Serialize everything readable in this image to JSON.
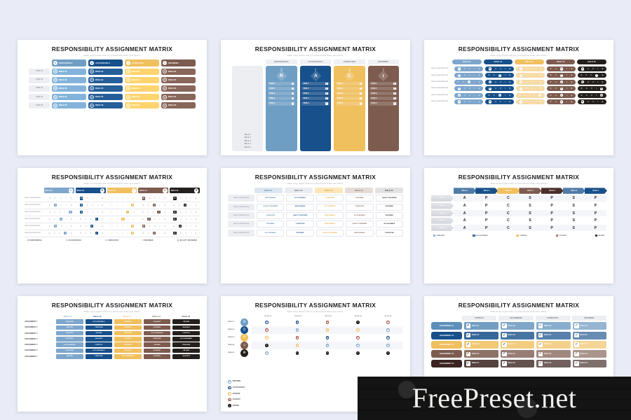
{
  "common": {
    "title": "RESPONSIBILITY ASSIGNMENT MATRIX",
    "subtitle": "Make a big impact with our professional slides and charts."
  },
  "palette": {
    "light_blue": "#7ea6cc",
    "navy": "#17508a",
    "gold": "#f0bf5e",
    "brown": "#7d5b4f",
    "dark": "#24201d",
    "steel": "#4f7ba6",
    "grey": "#eceef2",
    "page_bg": "#e9ecf6"
  },
  "watermark": {
    "text": "FreePreset.net"
  },
  "slide1": {
    "header": [
      {
        "letter": "R",
        "label": "RESPONSIBLE",
        "color": "#6f9ec4"
      },
      {
        "letter": "A",
        "label": "ACCOUNTABLE",
        "color": "#17508a"
      },
      {
        "letter": "C",
        "label": "CONSULTED",
        "color": "#f0bf5e"
      },
      {
        "letter": "I",
        "label": "INFORMED",
        "color": "#7d5b4f"
      }
    ],
    "rows": [
      {
        "task": "TASK 01",
        "cells": [
          "ROLE 01",
          "ROLE 02",
          "ROLE 03",
          "ROLE 04"
        ]
      },
      {
        "task": "TASK 02",
        "cells": [
          "ROLE 03",
          "ROLE 02",
          "ROLE 04",
          "ROLE 05"
        ]
      },
      {
        "task": "TASK 03",
        "cells": [
          "ROLE 04",
          "ROLE 05",
          "ROLE 01",
          "ROLE 03"
        ]
      },
      {
        "task": "TASK 04",
        "cells": [
          "ROLE 02",
          "ROLE 04",
          "ROLE 05",
          "ROLE 04"
        ]
      },
      {
        "task": "TASK 05",
        "cells": [
          "ROLE 02",
          "ROLE 03",
          "ROLE 04",
          "ROLE 05"
        ]
      }
    ],
    "cell_mark": "X"
  },
  "slide2": {
    "headers": [
      "RESPONSIBLE",
      "ACCOUNTABLE",
      "CONSULTED",
      "INFORMED"
    ],
    "letters": [
      "R",
      "A",
      "C",
      "I"
    ],
    "colors": [
      "#6f9ec4",
      "#17508a",
      "#f0bf5e",
      "#7d5b4f"
    ],
    "roles": [
      "ROLE 1",
      "ROLE 2",
      "ROLE 3",
      "ROLE 4",
      "ROLE 5"
    ],
    "tasks": [
      "TASK 1",
      "TASK 2",
      "TASK 3",
      "TASK 4",
      "TASK 5"
    ],
    "check": "✓"
  },
  "slide3": {
    "headers": [
      "ROLE 01",
      "ROLE 02",
      "ROLE 03",
      "ROLE 04",
      "ROLE 05"
    ],
    "colors": [
      "#7ea6cc",
      "#17508a",
      "#f0bf5e",
      "#7d5b4f",
      "#24201d"
    ],
    "letters": [
      "R",
      "A",
      "C",
      "I",
      "Q"
    ],
    "row_label": "TASK 0%d DESCRIPTION",
    "rows": [
      {
        "label": "TASK 01 DESCRIPTION",
        "active": [
          0,
          0,
          0,
          2,
          0
        ]
      },
      {
        "label": "TASK 02 DESCRIPTION",
        "active": [
          0,
          2,
          0,
          2,
          3
        ]
      },
      {
        "label": "TASK 03 DESCRIPTION",
        "active": [
          2,
          0,
          0,
          2,
          0
        ]
      },
      {
        "label": "TASK 04 DESCRIPTION",
        "active": [
          0,
          0,
          0,
          2,
          4
        ]
      },
      {
        "label": "TASK 05 DESCRIPTION",
        "active": [
          0,
          2,
          4,
          2,
          4
        ]
      },
      {
        "label": "TASK 06 DESCRIPTION",
        "active": [
          0,
          0,
          0,
          2,
          0
        ]
      }
    ]
  },
  "slide4": {
    "headers": [
      {
        "label": "ROLE 01",
        "letter": "A",
        "color": "#7ea6cc"
      },
      {
        "label": "ROLE 02",
        "letter": "B",
        "color": "#17508a"
      },
      {
        "label": "ROLE 03",
        "letter": "C",
        "color": "#f0bf5e"
      },
      {
        "label": "ROLE 04",
        "letter": "D",
        "color": "#7d5b4f"
      },
      {
        "label": "ROLE 05",
        "letter": "E",
        "color": "#24201d"
      }
    ],
    "letters": [
      "R",
      "A",
      "C",
      "I",
      "Q"
    ],
    "rows": [
      {
        "label": "TASK 01 DESCRIPTION",
        "active": [
          -1,
          0,
          -1,
          0,
          0
        ]
      },
      {
        "label": "TASK 02 DESCRIPTION",
        "active": [
          1,
          0,
          4,
          2,
          2
        ]
      },
      {
        "label": "TASK 03 DESCRIPTION",
        "active": [
          4,
          0,
          3,
          3,
          0
        ]
      },
      {
        "label": "TASK 04 DESCRIPTION",
        "active": [
          2,
          3,
          2,
          1,
          0
        ]
      },
      {
        "label": "TASK 05 DESCRIPTION",
        "active": [
          1,
          2,
          4,
          0,
          1
        ]
      },
      {
        "label": "TASK 06 DESCRIPTION",
        "active": [
          3,
          3,
          4,
          2,
          0
        ]
      }
    ],
    "legend": [
      "R: RESPONSIBLE",
      "A: ACCOUNTABLE",
      "C: CONSULTED",
      "I: INFORMED",
      "Q: QUALITY REVIEWER"
    ]
  },
  "slide5": {
    "headers": [
      "ROLE 01",
      "ROLE 02",
      "ROLE 03",
      "ROLE 04",
      "ROLE 05"
    ],
    "header_colors": [
      "#dbe6f0",
      "#e9ecf1",
      "#fbe7b8",
      "#e6dcd7",
      "#e2e2e2"
    ],
    "header_text_colors": [
      "#4f7ba6",
      "#5b6069",
      "#d39c2a",
      "#7d5b4f",
      "#3b3b3b"
    ],
    "rows": [
      {
        "label": "TASK 01 DESCRIPTION",
        "cells": [
          "RESPONSIBLE",
          "ACCOUNTABLE",
          "CONSULTED",
          "INFORMED",
          "QUALITY REVIEWER"
        ]
      },
      {
        "label": "TASK 02 DESCRIPTION",
        "cells": [
          "QUALITY REVIEWER",
          "RESPONSIBLE",
          "ACCOUNTABLE",
          "CONSULTED",
          "INFORMED"
        ]
      },
      {
        "label": "TASK 03 DESCRIPTION",
        "cells": [
          "CONSULTED",
          "QUALITY REVIEWER",
          "RESPONSIBLE",
          "ACCOUNTABLE",
          "INFORMED"
        ]
      },
      {
        "label": "TASK 04 DESCRIPTION",
        "cells": [
          "INFORMED",
          "CONSULTED",
          "RESPONSIBLE",
          "QUALITY REVIEWER",
          "ACCOUNTABLE"
        ]
      },
      {
        "label": "TASK 05 DESCRIPTION",
        "cells": [
          "ACCOUNTABLE",
          "INFORMED",
          "QUALITY REVIEWER",
          "RESPONSIBLE",
          "CONSULTED"
        ]
      }
    ],
    "cell_colors": [
      "#4f7ba6",
      "#17508a",
      "#e0a93c",
      "#7d5b4f",
      "#24201d"
    ]
  },
  "slide6": {
    "headers": [
      "ROLE 1",
      "ROLE 2",
      "ROLE 3",
      "ROLE 4",
      "ROLE 5",
      "ROLE 6",
      "ROLE 7"
    ],
    "header_colors": [
      "#4f7ba6",
      "#17508a",
      "#f0bf5e",
      "#7d5b4f",
      "#4a2f2a",
      "#4f7ba6",
      "#17508a"
    ],
    "tasks": [
      "TASK 01",
      "TASK 02",
      "TASK 03",
      "TASK 04",
      "TASK 05"
    ],
    "letters": [
      "A",
      "P",
      "C",
      "S",
      "P",
      "S",
      "P"
    ],
    "legend": [
      {
        "letter": "P",
        "label": "PERFORM",
        "color": "#7ea6cc"
      },
      {
        "letter": "A",
        "label": "ACCOUNTABLE",
        "color": "#17508a"
      },
      {
        "letter": "C",
        "label": "CONTROL",
        "color": "#f0bf5e"
      },
      {
        "letter": "S",
        "label": "SUGGEST",
        "color": "#a8574a"
      },
      {
        "letter": "I",
        "label": "INFORM",
        "color": "#24201d"
      }
    ]
  },
  "slide7": {
    "headers": [
      "ROLE 01",
      "ROLE 02",
      "ROLE 03",
      "ROLE 04",
      "ROLE 05"
    ],
    "header_colors": [
      "#7ea6cc",
      "#17508a",
      "#f0bf5e",
      "#7d5b4f",
      "#24201d"
    ],
    "rows": [
      {
        "label": "ASSIGNMENT 1",
        "cells": [
          "PERFORM",
          "ACCOUNTABLE",
          "CONTROL",
          "SUGGEST",
          "INFORM"
        ]
      },
      {
        "label": "ASSIGNMENT 2",
        "cells": [
          "INFORM",
          "PERFORM",
          "CONTROL",
          "CONTROL",
          "SUGGEST"
        ]
      },
      {
        "label": "ASSIGNMENT 3",
        "cells": [
          "SUGGEST",
          "INFORM",
          "PERFORM",
          "ACCOUNTABLE",
          "CONTROL"
        ]
      },
      {
        "label": "ASSIGNMENT 4",
        "cells": [
          "CONTROL",
          "SUGGEST",
          "INFORM",
          "PERFORM",
          "ACCOUNTABLE"
        ]
      },
      {
        "label": "ASSIGNMENT 5",
        "cells": [
          "ACCOUNTABLE",
          "CONTROL",
          "SUGGEST",
          "INFORM",
          "PERFORM"
        ]
      },
      {
        "label": "ASSIGNMENT 6",
        "cells": [
          "PERFORM",
          "ACCOUNTABLE",
          "CONTROL",
          "SUGGEST",
          "INFORM"
        ]
      },
      {
        "label": "ASSIGNMENT 7",
        "cells": [
          "INFORM",
          "PERFORM",
          "ACCOUNTABLE",
          "CONTROL",
          "SUGGEST"
        ]
      }
    ]
  },
  "slide8": {
    "headers": [
      "ROLE 01",
      "ROLE 02",
      "ROLE 03",
      "ROLE 04",
      "ROLE 05"
    ],
    "rows": [
      {
        "label": "TASK 01",
        "icon_color": "#6f9ec4",
        "icon": "⚙",
        "dots": [
          "#17508a",
          "#17508a",
          "#a8574a",
          "#24201d",
          "#a8574a"
        ]
      },
      {
        "label": "TASK 02",
        "icon_color": "#17508a",
        "icon": "⛭",
        "dots": [
          "#a8574a",
          "#7ea6cc",
          "#f0bf5e",
          "#f0bf5e",
          "#7ea6cc"
        ]
      },
      {
        "label": "TASK 03",
        "icon_color": "#f0bf5e",
        "icon": "⏱",
        "dots": [
          "#f0bf5e",
          "#a8574a",
          "#17508a",
          "#a8574a",
          "#17508a"
        ]
      },
      {
        "label": "TASK 04",
        "icon_color": "#7d5b4f",
        "icon": "☺",
        "dots": [
          "#24201d",
          "#f0bf5e",
          "#7ea6cc",
          "#7ea6cc",
          "#7ea6cc"
        ]
      },
      {
        "label": "TASK 05",
        "icon_color": "#24201d",
        "icon": "☸",
        "dots": [
          "#7ea6cc",
          "#24201d",
          "#24201d",
          "#24201d",
          "#24201d"
        ]
      }
    ],
    "dot_letters": [
      "P",
      "A",
      "C",
      "S",
      "I"
    ],
    "legend": [
      {
        "letter": "P",
        "label": "PERFORM",
        "color": "#7ea6cc"
      },
      {
        "letter": "A",
        "label": "ACCOUNTABLE",
        "color": "#17508a"
      },
      {
        "letter": "C",
        "label": "CONTROL",
        "color": "#f0bf5e"
      },
      {
        "letter": "S",
        "label": "SUGGEST",
        "color": "#a8574a"
      },
      {
        "letter": "I",
        "label": "INFORM",
        "color": "#24201d"
      }
    ]
  },
  "slide9": {
    "headers": [
      "APPROVE",
      "RECOMMEND",
      "CONSULTED",
      "INFORMED"
    ],
    "rows": [
      {
        "label": "ASSIGNMENT 01",
        "color": "#5d8fba",
        "cells": [
          "ROLE 01",
          "ROLE 02",
          "ROLE 03",
          "ROLE 04"
        ]
      },
      {
        "label": "ASSIGNMENT 02",
        "color": "#17508a",
        "cells": [
          "ROLE 02",
          "ROLE 03",
          "ROLE 04",
          "ROLE 05"
        ]
      },
      {
        "label": "ASSIGNMENT 03",
        "color": "#f0bf5e",
        "cells": [
          "ROLE 03",
          "ROLE 04",
          "ROLE 05",
          "ROLE 01"
        ]
      },
      {
        "label": "ASSIGNMENT 04",
        "color": "#7d5b4f",
        "cells": [
          "ROLE 01",
          "ROLE 02",
          "ROLE 03",
          "ROLE 04"
        ]
      },
      {
        "label": "ASSIGNMENT 05",
        "color": "#3b2420",
        "cells": [
          "ROLE 01",
          "ROLE 02",
          "ROLE 03",
          "ROLE 04"
        ]
      }
    ],
    "check": "✔"
  }
}
